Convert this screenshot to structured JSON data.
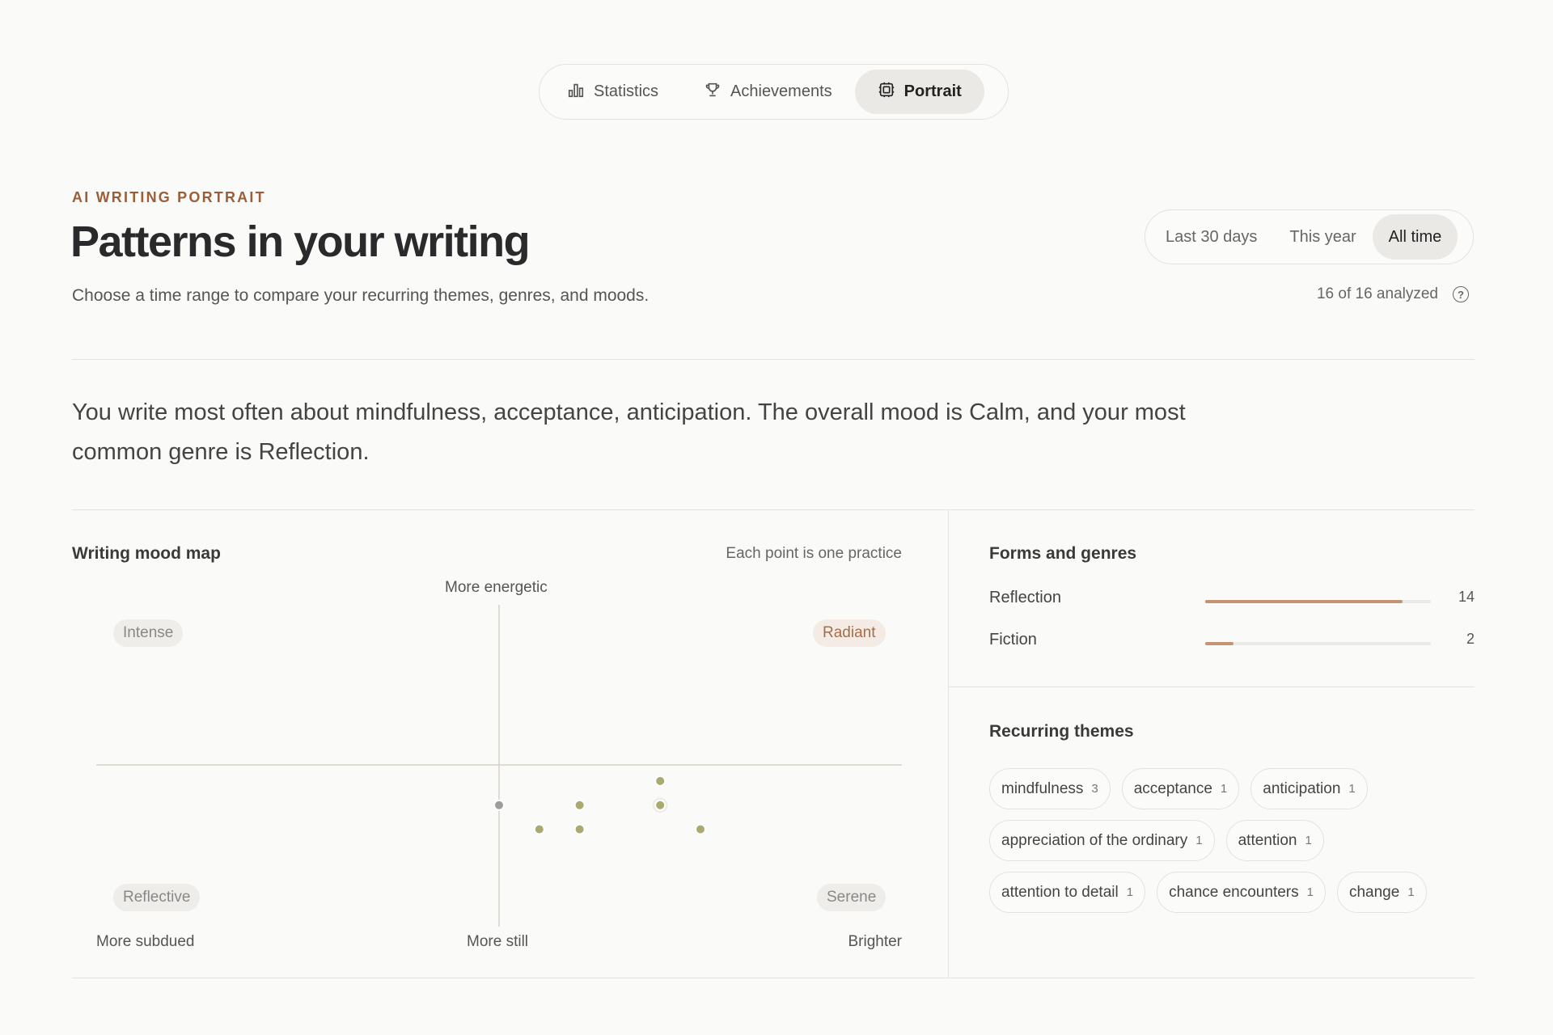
{
  "nav": {
    "tabs": [
      {
        "label": "Statistics",
        "icon": "bar-chart-icon",
        "active": false
      },
      {
        "label": "Achievements",
        "icon": "trophy-icon",
        "active": false
      },
      {
        "label": "Portrait",
        "icon": "portrait-icon",
        "active": true
      }
    ]
  },
  "header": {
    "eyebrow": "AI WRITING PORTRAIT",
    "title": "Patterns in your writing",
    "subtitle": "Choose a time range to compare your recurring themes, genres, and moods.",
    "ranges": [
      {
        "label": "Last 30 days",
        "active": false
      },
      {
        "label": "This year",
        "active": false
      },
      {
        "label": "All time",
        "active": true
      }
    ],
    "analyzed": "16 of 16 analyzed"
  },
  "summary": "You write most often about mindfulness, acceptance, anticipation. The overall mood is Calm, and your most common genre is Reflection.",
  "mood_map": {
    "title": "Writing mood map",
    "note": "Each point is one practice",
    "axis_top": "More energetic",
    "axis_bottom_left": "More subdued",
    "axis_bottom_center": "More still",
    "axis_bottom_right": "Brighter",
    "quadrants": {
      "top_left": "Intense",
      "top_right": "Radiant",
      "bottom_left": "Reflective",
      "bottom_right": "Serene"
    },
    "colors": {
      "point": "#a8aa6e",
      "point_neutral": "#9d9d9d",
      "axis": "#d8d2c8"
    }
  },
  "chart_data": {
    "type": "scatter",
    "title": "Writing mood map",
    "xlabel": "Brighter",
    "ylabel": "More energetic",
    "xlim": [
      -1,
      1
    ],
    "ylim": [
      -1,
      1
    ],
    "points": [
      {
        "x": 0.4,
        "y": -0.1,
        "tone": "positive",
        "stacked": false
      },
      {
        "x": 0.2,
        "y": -0.25,
        "tone": "positive",
        "stacked": false
      },
      {
        "x": 0.4,
        "y": -0.25,
        "tone": "positive",
        "stacked": true
      },
      {
        "x": 0.0,
        "y": -0.25,
        "tone": "neutral",
        "stacked": false
      },
      {
        "x": 0.1,
        "y": -0.4,
        "tone": "positive",
        "stacked": false
      },
      {
        "x": 0.2,
        "y": -0.4,
        "tone": "positive",
        "stacked": false
      },
      {
        "x": 0.5,
        "y": -0.4,
        "tone": "positive",
        "stacked": false
      }
    ]
  },
  "genres": {
    "title": "Forms and genres",
    "max": 16,
    "items": [
      {
        "label": "Reflection",
        "count": "14",
        "value": 14
      },
      {
        "label": "Fiction",
        "count": "2",
        "value": 2
      }
    ]
  },
  "themes": {
    "title": "Recurring themes",
    "lines": [
      [
        {
          "label": "mindfulness",
          "count": "3"
        },
        {
          "label": "acceptance",
          "count": "1"
        },
        {
          "label": "anticipation",
          "count": "1"
        }
      ],
      [
        {
          "label": "appreciation of the ordinary",
          "count": "1"
        },
        {
          "label": "attention",
          "count": "1"
        }
      ],
      [
        {
          "label": "attention to detail",
          "count": "1"
        },
        {
          "label": "chance encounters",
          "count": "1"
        },
        {
          "label": "change",
          "count": "1"
        }
      ]
    ]
  }
}
